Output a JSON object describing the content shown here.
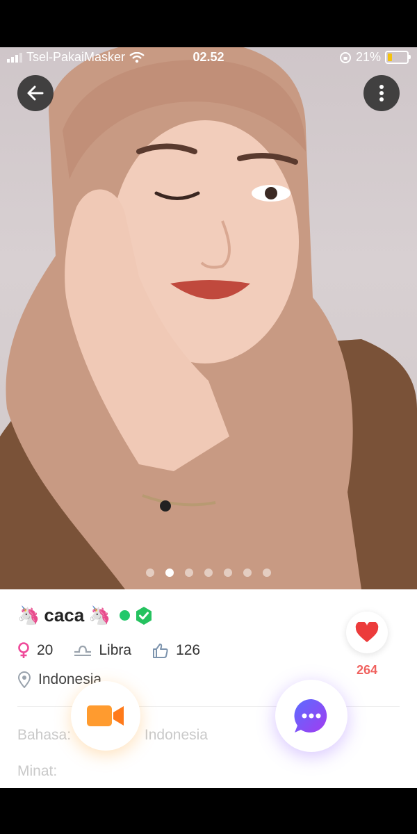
{
  "status_bar": {
    "carrier": "Tsel-PakaiMasker",
    "time": "02.52",
    "battery": "21%"
  },
  "gallery": {
    "photo_count": 7,
    "active_index": 1
  },
  "profile": {
    "name": "caca",
    "name_emoji": "🦄",
    "age": "20",
    "zodiac": "Libra",
    "likes_given": "126",
    "location": "Indonesia",
    "heart_count": "264",
    "language_label": "Bahasa:",
    "language_value": "Indonesia",
    "interests_label": "Minat:"
  },
  "colors": {
    "accent_pink": "#f0625f",
    "online_green": "#22c86a",
    "verified_green": "#25c25f",
    "video_orange": "#ff9b2f",
    "chat_purple": "#7b4dff"
  }
}
